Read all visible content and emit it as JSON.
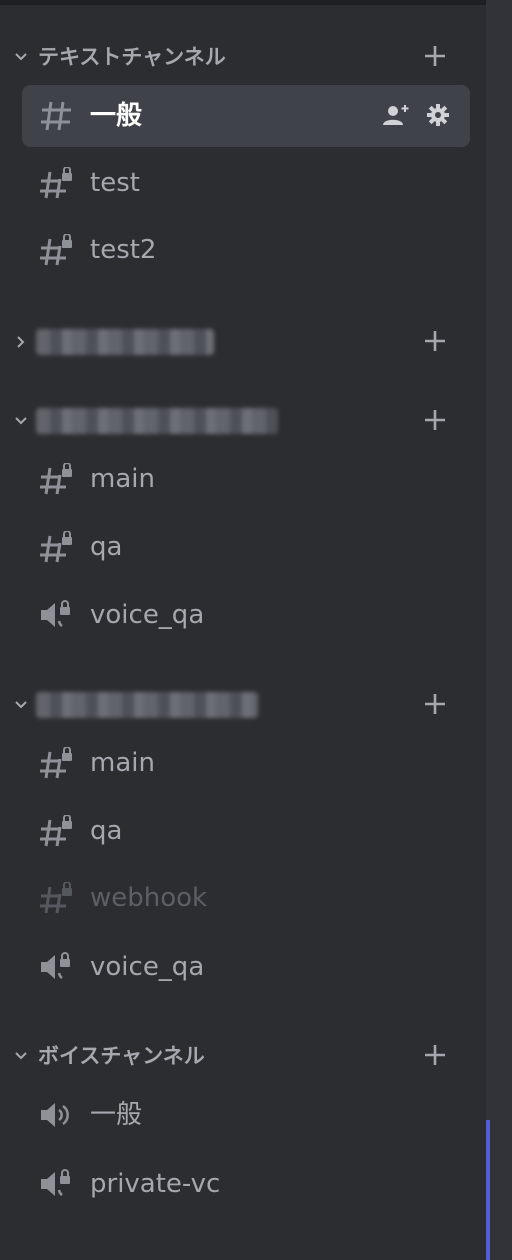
{
  "colors": {
    "background": "#2b2d31",
    "selected_bg": "#3f4248",
    "text_muted": "#a5a8ae",
    "text_active": "#ffffff",
    "text_faded": "#5c5f66",
    "accent": "#5865f2"
  },
  "categories": [
    {
      "label": "テキストチャンネル",
      "expanded": true,
      "channels": [
        {
          "name": "一般",
          "icon": "text-channel-icon",
          "selected": true
        },
        {
          "name": "test",
          "icon": "locked-text-channel-icon"
        },
        {
          "name": "test2",
          "icon": "locked-text-channel-icon"
        }
      ]
    },
    {
      "label": "",
      "expanded": false,
      "label_redacted": true,
      "channels": []
    },
    {
      "label": "",
      "expanded": true,
      "label_redacted": true,
      "channels": [
        {
          "name": "main",
          "icon": "locked-text-channel-icon"
        },
        {
          "name": "qa",
          "icon": "locked-text-channel-icon"
        },
        {
          "name": "voice_qa",
          "icon": "locked-voice-channel-icon"
        }
      ]
    },
    {
      "label": "",
      "expanded": true,
      "label_redacted": true,
      "channels": [
        {
          "name": "main",
          "icon": "locked-text-channel-icon"
        },
        {
          "name": "qa",
          "icon": "locked-text-channel-icon"
        },
        {
          "name": "webhook",
          "icon": "locked-text-channel-icon",
          "muted": true
        },
        {
          "name": "voice_qa",
          "icon": "locked-voice-channel-icon"
        }
      ]
    },
    {
      "label": "ボイスチャンネル",
      "expanded": true,
      "channels": [
        {
          "name": "一般",
          "icon": "voice-channel-icon"
        },
        {
          "name": "private-vc",
          "icon": "locked-voice-channel-icon"
        }
      ]
    }
  ],
  "selected_channel_actions": [
    "add-member-icon",
    "gear-icon"
  ]
}
